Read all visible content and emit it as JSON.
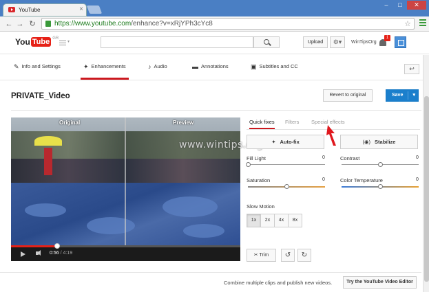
{
  "browser": {
    "tab_title": "YouTube",
    "url_host": "https://www.youtube.com",
    "url_path": "/enhance?v=xRjYPh3cYc8"
  },
  "header": {
    "logo_you": "You",
    "logo_tube": "Tube",
    "logo_region": "GR",
    "search_placeholder": "",
    "upload_label": "Upload",
    "username": "WinTipsOrg",
    "notification_count": "1"
  },
  "editor_tabs": [
    {
      "label": "Info and Settings",
      "icon": "pencil-icon"
    },
    {
      "label": "Enhancements",
      "icon": "magic-wand-icon",
      "active": true
    },
    {
      "label": "Audio",
      "icon": "music-note-icon"
    },
    {
      "label": "Annotations",
      "icon": "speech-bubble-icon"
    },
    {
      "label": "Subtitles and CC",
      "icon": "cc-icon"
    }
  ],
  "title_row": {
    "video_title": "PRIVATE_Video",
    "revert_label": "Revert to original",
    "save_label": "Save"
  },
  "video": {
    "label_original": "Original",
    "label_preview": "Preview",
    "current_time": "0:56",
    "duration": "/ 4:19",
    "progress_fraction": 0.2
  },
  "watermark": "www.wintips.org",
  "panel": {
    "tabs": [
      "Quick fixes",
      "Filters",
      "Special effects"
    ],
    "active_tab": "Quick fixes",
    "autofix_label": "Auto-fix",
    "stabilize_label": "Stabilize",
    "sliders": [
      {
        "label": "Fill Light",
        "value": "0",
        "level": 0.0
      },
      {
        "label": "Contrast",
        "value": "0",
        "level": 0.5
      },
      {
        "label": "Saturation",
        "value": "0",
        "level": 0.5
      },
      {
        "label": "Color Temperature",
        "value": "0",
        "level": 0.5
      }
    ],
    "slow_motion_label": "Slow Motion",
    "speeds": [
      "1x",
      "2x",
      "4x",
      "8x"
    ],
    "active_speed": "1x",
    "trim_label": "Trim"
  },
  "footer": {
    "text": "Combine multiple clips and publish new videos.",
    "button": "Try the YouTube Video Editor"
  },
  "colors": {
    "accent_red": "#cc181e",
    "save_blue": "#1b7fcc",
    "youtube_red": "#e62117"
  }
}
